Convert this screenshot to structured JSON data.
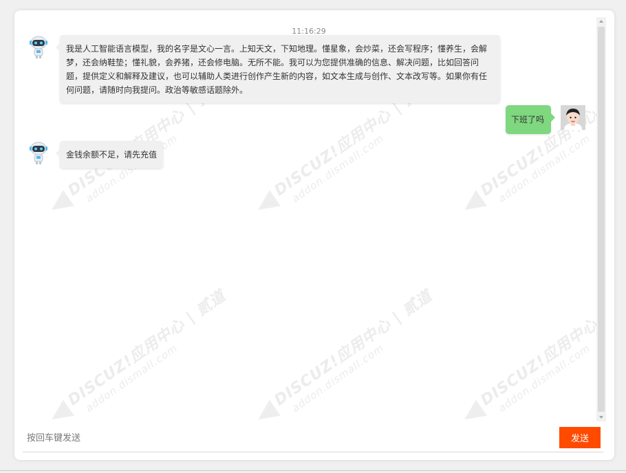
{
  "chat": {
    "timestamp": "11:16:29",
    "messages": [
      {
        "from": "bot",
        "avatar_icon": "robot-avatar-icon",
        "text": "我是人工智能语言模型，我的名字是文心一言。上知天文，下知地理。懂星象，会炒菜，还会写程序；懂养生，会解梦，还会纳鞋垫；懂礼貌，会养猪，还会修电脑。无所不能。我可以为您提供准确的信息、解决问题，比如回答问题，提供定义和解释及建议，也可以辅助人类进行创作产生新的内容，如文本生成与创作、文本改写等。如果你有任何问题，请随时向我提问。政治等敏感话题除外。"
      },
      {
        "from": "user",
        "avatar_icon": "user-avatar-icon",
        "text": "下班了吗"
      },
      {
        "from": "bot",
        "avatar_icon": "robot-avatar-icon",
        "text": "金钱余额不足，请先充值"
      }
    ]
  },
  "watermark": {
    "line1": "DISCUZ!应用中心 | 贰道",
    "line2": "addon.dismall.com"
  },
  "composer": {
    "placeholder": "按回车键发送",
    "send_label": "发送"
  },
  "colors": {
    "send_button": "#ff4a00",
    "user_bubble": "#7fd77f",
    "bot_bubble": "#f0f0f0"
  }
}
